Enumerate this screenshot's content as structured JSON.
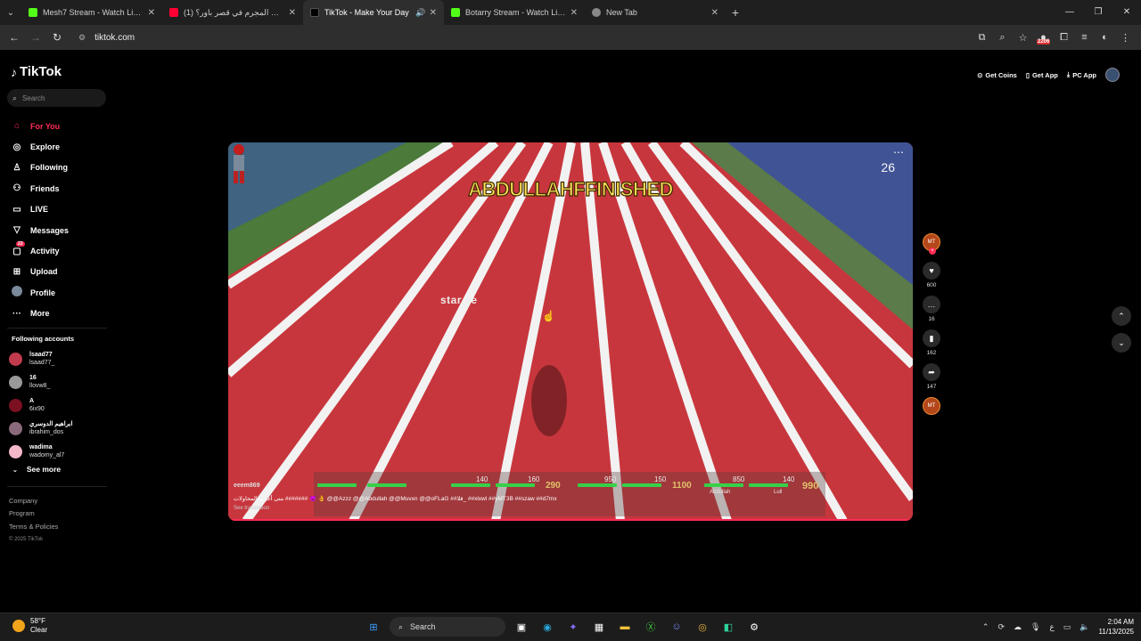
{
  "browser": {
    "tabs": [
      {
        "title": "Mesh7 Stream - Watch Live on",
        "favicon_color": "#53fc18",
        "active": false,
        "audio": false
      },
      {
        "title": "(1) مين المجرم في قصر باور؟ - ...",
        "favicon_color": "#ff0033",
        "active": false,
        "audio": false
      },
      {
        "title": "TikTok - Make Your Day",
        "favicon_color": "#000000",
        "active": true,
        "audio": true
      },
      {
        "title": "Botarry Stream - Watch Live on",
        "favicon_color": "#53fc18",
        "active": false,
        "audio": false
      },
      {
        "title": "New Tab",
        "favicon_color": "#888888",
        "active": false,
        "audio": false
      }
    ],
    "url": "tiktok.com",
    "extension_badge": "2206"
  },
  "tiktok": {
    "logo": "TikTok",
    "search_placeholder": "Search",
    "menu": [
      {
        "label": "For You",
        "icon": "home-icon",
        "active": true
      },
      {
        "label": "Explore",
        "icon": "compass-icon",
        "active": false
      },
      {
        "label": "Following",
        "icon": "following-icon",
        "active": false
      },
      {
        "label": "Friends",
        "icon": "friends-icon",
        "active": false
      },
      {
        "label": "LIVE",
        "icon": "live-icon",
        "active": false
      },
      {
        "label": "Messages",
        "icon": "messages-icon",
        "active": false
      },
      {
        "label": "Activity",
        "icon": "activity-icon",
        "active": false,
        "badge": "23"
      },
      {
        "label": "Upload",
        "icon": "upload-icon",
        "active": false
      },
      {
        "label": "Profile",
        "icon": "profile-icon",
        "active": false
      },
      {
        "label": "More",
        "icon": "more-icon",
        "active": false
      }
    ],
    "following_header": "Following accounts",
    "following": [
      {
        "name": "lsaad77",
        "handle": "lsaad77_",
        "color": "#c23b4d"
      },
      {
        "name": "16",
        "handle": "llovw8_",
        "color": "#999999"
      },
      {
        "name": "A",
        "handle": "6ix90",
        "color": "#7a1020"
      },
      {
        "name": "ابراهيم الدوسري",
        "handle": "ibrahim_dos",
        "color": "#8a6a7a"
      },
      {
        "name": "wadima",
        "handle": "wadomy_al7",
        "color": "#f2b8c8"
      }
    ],
    "see_more": "See more",
    "footer": [
      "Company",
      "Program",
      "Terms & Policies"
    ],
    "copyright": "© 2025 TikTok",
    "top_actions": [
      "Get Coins",
      "Get App",
      "PC App"
    ]
  },
  "video": {
    "banner": "ABDULLAHFFINISHED",
    "counter": "26",
    "overlay_text": "star.ee",
    "author": "eeem869",
    "caption": "متى أغرب المحاولات #######  😈 👌 @@Azzz @@Abdullah @@Muvxn @@oFLaG ##قلا_ ##xlxwl ##yMT3B ##szaw ##d7mx",
    "see_translation": "See translation",
    "hud_values": [
      "140",
      "160",
      "290",
      "950",
      "150",
      "1100",
      "850",
      "140",
      "990"
    ],
    "hud_labels": [
      "Abdullah",
      "Lull"
    ],
    "likes": "600",
    "comments": "16",
    "saves": "162",
    "shares": "147",
    "creator_initials": "MT"
  },
  "taskbar": {
    "temperature": "58°F",
    "weather": "Clear",
    "search_label": "Search",
    "time": "2:04 AM",
    "date": "11/13/2025",
    "lang": "ع"
  }
}
